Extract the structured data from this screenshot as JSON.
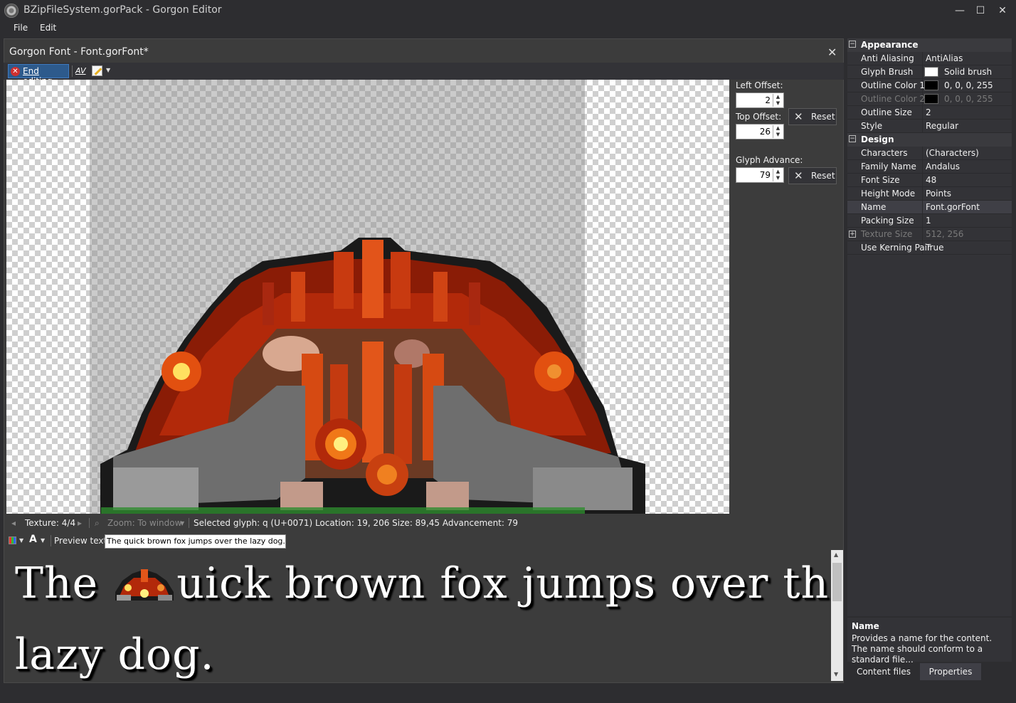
{
  "window": {
    "title": "BZipFileSystem.gorPack - Gorgon Editor",
    "minimize": "—",
    "maximize": "☐",
    "close": "✕"
  },
  "menu": [
    "File",
    "Edit"
  ],
  "document": {
    "title": "Gorgon Font - Font.gorFont*",
    "close": "✕"
  },
  "toolbar": {
    "end_editing": "End editing",
    "kerning_icon": "AV",
    "brush_icon": "pencil-icon"
  },
  "offsets": {
    "left_label": "Left Offset:",
    "left_value": "2",
    "top_label": "Top Offset:",
    "top_value": "26",
    "advance_label": "Glyph Advance:",
    "advance_value": "79",
    "reset": "Reset"
  },
  "status": {
    "texture": "Texture: 4/4",
    "zoom": "Zoom: To window",
    "selected": "Selected glyph: q (U+0071) Location: 19, 206 Size: 89,45 Advancement: 79"
  },
  "preview": {
    "label": "Preview text:",
    "value": "The quick brown fox jumps over the lazy dog.\\n",
    "line1_before": "The ",
    "line1_after": "uick brown fox jumps over the",
    "line2": "lazy dog."
  },
  "properties": {
    "categories": [
      {
        "name": "Appearance",
        "toggle": "−",
        "rows": [
          {
            "name": "Anti Aliasing",
            "value": "AntiAlias"
          },
          {
            "name": "Glyph Brush",
            "value": "Solid brush",
            "swatch": "#ffffff"
          },
          {
            "name": "Outline Color 1",
            "value": "0, 0, 0, 255",
            "swatch": "#000000"
          },
          {
            "name": "Outline Color 2",
            "value": "0, 0, 0, 255",
            "swatch": "#000000",
            "disabled": true
          },
          {
            "name": "Outline Size",
            "value": "2"
          },
          {
            "name": "Style",
            "value": "Regular"
          }
        ]
      },
      {
        "name": "Design",
        "toggle": "−",
        "rows": [
          {
            "name": "Characters",
            "value": "(Characters)"
          },
          {
            "name": "Family Name",
            "value": "Andalus"
          },
          {
            "name": "Font Size",
            "value": "48"
          },
          {
            "name": "Height Mode",
            "value": "Points"
          },
          {
            "name": "Name",
            "value": "Font.gorFont",
            "selected": true
          },
          {
            "name": "Packing Size",
            "value": "1"
          },
          {
            "name": "Texture Size",
            "value": "512, 256",
            "disabled": true,
            "expandable": true
          },
          {
            "name": "Use Kerning Pair",
            "value": "True"
          }
        ]
      }
    ],
    "description_title": "Name",
    "description_text": "Provides a name for the content.  The name should conform to a standard file..."
  },
  "tabs": [
    "Content files",
    "Properties"
  ],
  "colors": {
    "glyph_dark": "#1a1a1a",
    "glyph_red": "#b2290a",
    "glyph_orange": "#f05a10",
    "glyph_yellow": "#ffe060",
    "glyph_gray": "#8a8a8a",
    "glyph_brown": "#6b3a24",
    "baseline": "#2e8b2e"
  }
}
